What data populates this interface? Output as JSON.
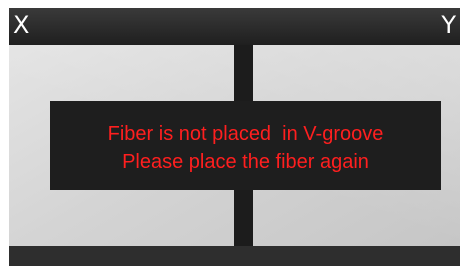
{
  "header": {
    "left_label": "X",
    "right_label": "Y"
  },
  "message": {
    "line1": "Fiber is not placed  in V-groove",
    "line2": "Please place the fiber again"
  },
  "colors": {
    "message_text": "#ff1f1f",
    "message_background": "#1e1e1e"
  }
}
